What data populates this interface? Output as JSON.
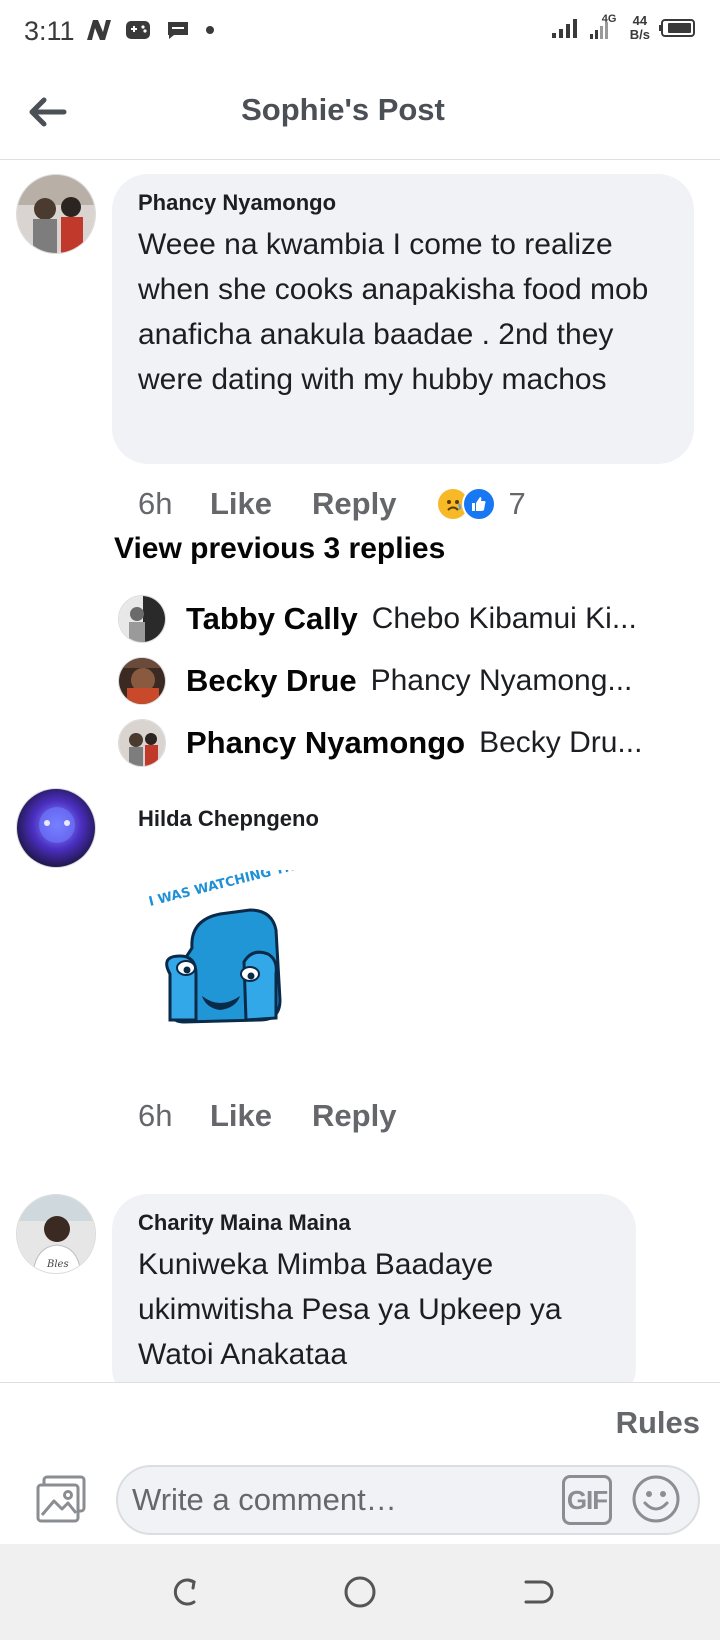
{
  "status_bar": {
    "time": "3:11",
    "network_type": "4G",
    "net_speed_value": "44",
    "net_speed_unit": "B/s"
  },
  "header": {
    "title": "Sophie's Post",
    "back_icon": "arrow-left-icon"
  },
  "comments": [
    {
      "author": "Phancy Nyamongo",
      "text": "Weee na kwambia I come to realize when she cooks anapakisha food mob anaficha anakula baadae . 2nd they were dating with my hubby machos",
      "time": "6h",
      "like_label": "Like",
      "reply_label": "Reply",
      "reaction_icons": [
        "sad-reaction-icon",
        "like-reaction-icon"
      ],
      "reaction_count": "7"
    },
    {
      "author": "Hilda Chepngeno",
      "sticker_text": "I WAS WATCHING THAT.",
      "sticker_icon": "armchair-sticker-icon",
      "time": "6h",
      "like_label": "Like",
      "reply_label": "Reply"
    },
    {
      "author": "Charity Maina Maina",
      "text": "Kuniweka Mimba Baadaye ukimwitisha Pesa ya Upkeep ya Watoi Anakataa"
    }
  ],
  "replies": {
    "view_previous_label": "View previous 3 replies",
    "items": [
      {
        "name": "Tabby Cally",
        "snippet": "Chebo Kibamui Ki..."
      },
      {
        "name": "Becky Drue",
        "snippet": "Phancy Nyamong..."
      },
      {
        "name": "Phancy Nyamongo",
        "snippet": "Becky Dru..."
      }
    ]
  },
  "composer": {
    "rules_label": "Rules",
    "placeholder": "Write a comment…",
    "gif_label": "GIF",
    "photo_icon": "photo-icon",
    "emoji_icon": "smiley-icon"
  },
  "nav": {
    "recents_icon": "recents-icon",
    "home_icon": "home-circle-icon",
    "back_icon": "nav-back-icon"
  },
  "colors": {
    "bubble": "#f0f2f5",
    "secondary_text": "#65676b",
    "like_blue": "#1877f2",
    "sad_yellow": "#f7b928",
    "sticker_blue": "#1e90d6"
  }
}
